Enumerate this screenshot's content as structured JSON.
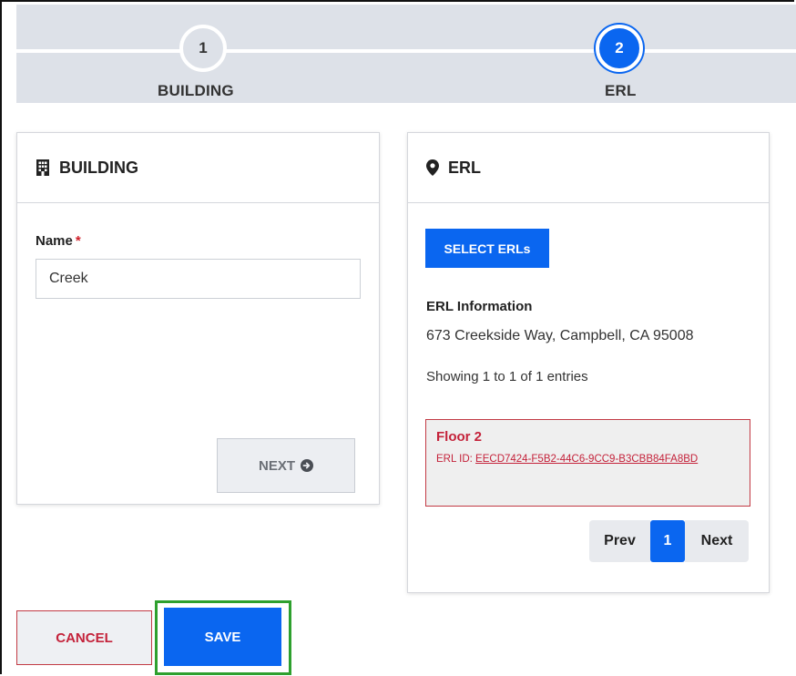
{
  "stepper": {
    "steps": [
      {
        "number": "1",
        "label": "BUILDING",
        "state": "complete"
      },
      {
        "number": "2",
        "label": "ERL",
        "state": "active"
      }
    ]
  },
  "building_card": {
    "title": "BUILDING",
    "icon": "building-icon",
    "name_label": "Name",
    "required_mark": "*",
    "name_value": "Creek",
    "next_label": "NEXT"
  },
  "erl_card": {
    "title": "ERL",
    "icon": "map-pin-icon",
    "select_label": "SELECT ERLs",
    "info_title": "ERL Information",
    "address": "673 Creekside Way, Campbell, CA 95008",
    "showing": "Showing 1 to 1 of 1 entries",
    "entry": {
      "floor": "Floor 2",
      "id_label": "ERL ID:",
      "id_value": "EECD7424-F5B2-44C6-9CC9-B3CBB84FA8BD"
    },
    "pagination": {
      "prev": "Prev",
      "current": "1",
      "next": "Next"
    }
  },
  "actions": {
    "cancel_label": "CANCEL",
    "save_label": "SAVE"
  },
  "colors": {
    "primary": "#0a66f0",
    "danger": "#c4223a",
    "highlight": "#2ea02e"
  }
}
